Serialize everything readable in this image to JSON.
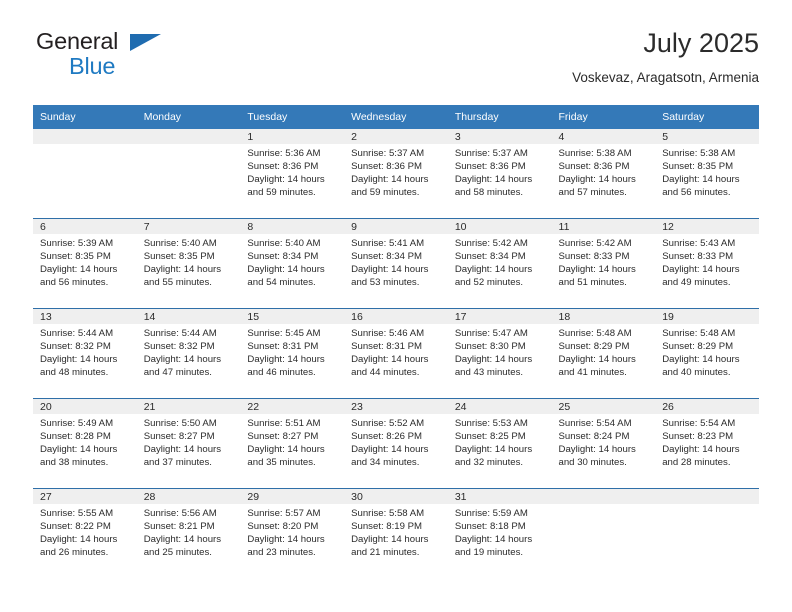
{
  "brand": {
    "name_top": "General",
    "name_bottom": "Blue",
    "accent_color": "#1f7ac2"
  },
  "header": {
    "month_title": "July 2025",
    "location": "Voskevaz, Aragatsotn, Armenia"
  },
  "calendar": {
    "header_color": "#3479b8",
    "weekday_headers": [
      "Sunday",
      "Monday",
      "Tuesday",
      "Wednesday",
      "Thursday",
      "Friday",
      "Saturday"
    ],
    "weeks": [
      [
        {
          "day": "",
          "sunrise": "",
          "sunset": "",
          "daylight_a": "",
          "daylight_b": "",
          "empty": true
        },
        {
          "day": "",
          "sunrise": "",
          "sunset": "",
          "daylight_a": "",
          "daylight_b": "",
          "empty": true
        },
        {
          "day": "1",
          "sunrise": "Sunrise: 5:36 AM",
          "sunset": "Sunset: 8:36 PM",
          "daylight_a": "Daylight: 14 hours",
          "daylight_b": "and 59 minutes.",
          "empty": false
        },
        {
          "day": "2",
          "sunrise": "Sunrise: 5:37 AM",
          "sunset": "Sunset: 8:36 PM",
          "daylight_a": "Daylight: 14 hours",
          "daylight_b": "and 59 minutes.",
          "empty": false
        },
        {
          "day": "3",
          "sunrise": "Sunrise: 5:37 AM",
          "sunset": "Sunset: 8:36 PM",
          "daylight_a": "Daylight: 14 hours",
          "daylight_b": "and 58 minutes.",
          "empty": false
        },
        {
          "day": "4",
          "sunrise": "Sunrise: 5:38 AM",
          "sunset": "Sunset: 8:36 PM",
          "daylight_a": "Daylight: 14 hours",
          "daylight_b": "and 57 minutes.",
          "empty": false
        },
        {
          "day": "5",
          "sunrise": "Sunrise: 5:38 AM",
          "sunset": "Sunset: 8:35 PM",
          "daylight_a": "Daylight: 14 hours",
          "daylight_b": "and 56 minutes.",
          "empty": false
        }
      ],
      [
        {
          "day": "6",
          "sunrise": "Sunrise: 5:39 AM",
          "sunset": "Sunset: 8:35 PM",
          "daylight_a": "Daylight: 14 hours",
          "daylight_b": "and 56 minutes.",
          "empty": false
        },
        {
          "day": "7",
          "sunrise": "Sunrise: 5:40 AM",
          "sunset": "Sunset: 8:35 PM",
          "daylight_a": "Daylight: 14 hours",
          "daylight_b": "and 55 minutes.",
          "empty": false
        },
        {
          "day": "8",
          "sunrise": "Sunrise: 5:40 AM",
          "sunset": "Sunset: 8:34 PM",
          "daylight_a": "Daylight: 14 hours",
          "daylight_b": "and 54 minutes.",
          "empty": false
        },
        {
          "day": "9",
          "sunrise": "Sunrise: 5:41 AM",
          "sunset": "Sunset: 8:34 PM",
          "daylight_a": "Daylight: 14 hours",
          "daylight_b": "and 53 minutes.",
          "empty": false
        },
        {
          "day": "10",
          "sunrise": "Sunrise: 5:42 AM",
          "sunset": "Sunset: 8:34 PM",
          "daylight_a": "Daylight: 14 hours",
          "daylight_b": "and 52 minutes.",
          "empty": false
        },
        {
          "day": "11",
          "sunrise": "Sunrise: 5:42 AM",
          "sunset": "Sunset: 8:33 PM",
          "daylight_a": "Daylight: 14 hours",
          "daylight_b": "and 51 minutes.",
          "empty": false
        },
        {
          "day": "12",
          "sunrise": "Sunrise: 5:43 AM",
          "sunset": "Sunset: 8:33 PM",
          "daylight_a": "Daylight: 14 hours",
          "daylight_b": "and 49 minutes.",
          "empty": false
        }
      ],
      [
        {
          "day": "13",
          "sunrise": "Sunrise: 5:44 AM",
          "sunset": "Sunset: 8:32 PM",
          "daylight_a": "Daylight: 14 hours",
          "daylight_b": "and 48 minutes.",
          "empty": false
        },
        {
          "day": "14",
          "sunrise": "Sunrise: 5:44 AM",
          "sunset": "Sunset: 8:32 PM",
          "daylight_a": "Daylight: 14 hours",
          "daylight_b": "and 47 minutes.",
          "empty": false
        },
        {
          "day": "15",
          "sunrise": "Sunrise: 5:45 AM",
          "sunset": "Sunset: 8:31 PM",
          "daylight_a": "Daylight: 14 hours",
          "daylight_b": "and 46 minutes.",
          "empty": false
        },
        {
          "day": "16",
          "sunrise": "Sunrise: 5:46 AM",
          "sunset": "Sunset: 8:31 PM",
          "daylight_a": "Daylight: 14 hours",
          "daylight_b": "and 44 minutes.",
          "empty": false
        },
        {
          "day": "17",
          "sunrise": "Sunrise: 5:47 AM",
          "sunset": "Sunset: 8:30 PM",
          "daylight_a": "Daylight: 14 hours",
          "daylight_b": "and 43 minutes.",
          "empty": false
        },
        {
          "day": "18",
          "sunrise": "Sunrise: 5:48 AM",
          "sunset": "Sunset: 8:29 PM",
          "daylight_a": "Daylight: 14 hours",
          "daylight_b": "and 41 minutes.",
          "empty": false
        },
        {
          "day": "19",
          "sunrise": "Sunrise: 5:48 AM",
          "sunset": "Sunset: 8:29 PM",
          "daylight_a": "Daylight: 14 hours",
          "daylight_b": "and 40 minutes.",
          "empty": false
        }
      ],
      [
        {
          "day": "20",
          "sunrise": "Sunrise: 5:49 AM",
          "sunset": "Sunset: 8:28 PM",
          "daylight_a": "Daylight: 14 hours",
          "daylight_b": "and 38 minutes.",
          "empty": false
        },
        {
          "day": "21",
          "sunrise": "Sunrise: 5:50 AM",
          "sunset": "Sunset: 8:27 PM",
          "daylight_a": "Daylight: 14 hours",
          "daylight_b": "and 37 minutes.",
          "empty": false
        },
        {
          "day": "22",
          "sunrise": "Sunrise: 5:51 AM",
          "sunset": "Sunset: 8:27 PM",
          "daylight_a": "Daylight: 14 hours",
          "daylight_b": "and 35 minutes.",
          "empty": false
        },
        {
          "day": "23",
          "sunrise": "Sunrise: 5:52 AM",
          "sunset": "Sunset: 8:26 PM",
          "daylight_a": "Daylight: 14 hours",
          "daylight_b": "and 34 minutes.",
          "empty": false
        },
        {
          "day": "24",
          "sunrise": "Sunrise: 5:53 AM",
          "sunset": "Sunset: 8:25 PM",
          "daylight_a": "Daylight: 14 hours",
          "daylight_b": "and 32 minutes.",
          "empty": false
        },
        {
          "day": "25",
          "sunrise": "Sunrise: 5:54 AM",
          "sunset": "Sunset: 8:24 PM",
          "daylight_a": "Daylight: 14 hours",
          "daylight_b": "and 30 minutes.",
          "empty": false
        },
        {
          "day": "26",
          "sunrise": "Sunrise: 5:54 AM",
          "sunset": "Sunset: 8:23 PM",
          "daylight_a": "Daylight: 14 hours",
          "daylight_b": "and 28 minutes.",
          "empty": false
        }
      ],
      [
        {
          "day": "27",
          "sunrise": "Sunrise: 5:55 AM",
          "sunset": "Sunset: 8:22 PM",
          "daylight_a": "Daylight: 14 hours",
          "daylight_b": "and 26 minutes.",
          "empty": false
        },
        {
          "day": "28",
          "sunrise": "Sunrise: 5:56 AM",
          "sunset": "Sunset: 8:21 PM",
          "daylight_a": "Daylight: 14 hours",
          "daylight_b": "and 25 minutes.",
          "empty": false
        },
        {
          "day": "29",
          "sunrise": "Sunrise: 5:57 AM",
          "sunset": "Sunset: 8:20 PM",
          "daylight_a": "Daylight: 14 hours",
          "daylight_b": "and 23 minutes.",
          "empty": false
        },
        {
          "day": "30",
          "sunrise": "Sunrise: 5:58 AM",
          "sunset": "Sunset: 8:19 PM",
          "daylight_a": "Daylight: 14 hours",
          "daylight_b": "and 21 minutes.",
          "empty": false
        },
        {
          "day": "31",
          "sunrise": "Sunrise: 5:59 AM",
          "sunset": "Sunset: 8:18 PM",
          "daylight_a": "Daylight: 14 hours",
          "daylight_b": "and 19 minutes.",
          "empty": false
        },
        {
          "day": "",
          "sunrise": "",
          "sunset": "",
          "daylight_a": "",
          "daylight_b": "",
          "empty": true
        },
        {
          "day": "",
          "sunrise": "",
          "sunset": "",
          "daylight_a": "",
          "daylight_b": "",
          "empty": true
        }
      ]
    ]
  }
}
